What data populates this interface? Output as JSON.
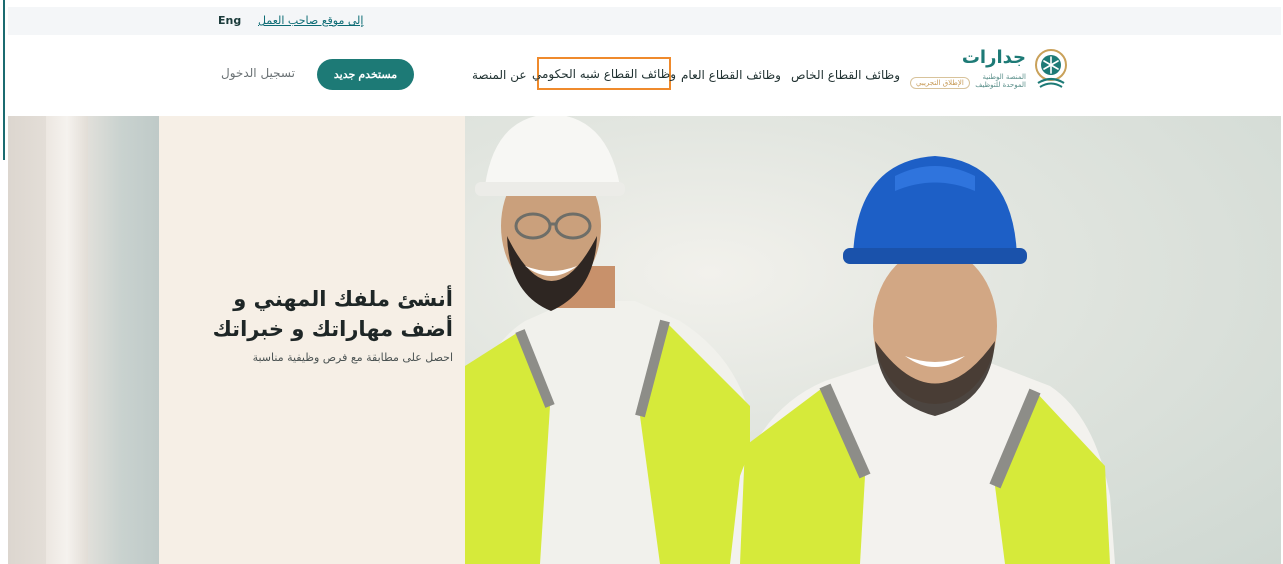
{
  "topbar": {
    "lang_label": "Eng",
    "employer_link": "إلى موقع صاحب العمل"
  },
  "header": {
    "login_label": "تسجيل الدخول",
    "new_user_label": "مستخدم جديد",
    "nav": {
      "about": "عن المنصة",
      "semi_government": "وظائف القطاع شبه الحكومي",
      "public": "وظائف القطاع العام",
      "private": "وظائف القطاع الخاص"
    },
    "logo": {
      "name": "جدارات",
      "subtitle": "المنصة الوطنية الموحدة للتوظيف",
      "beta_badge": "الإطلاق التجريبي"
    }
  },
  "hero": {
    "headline": "أنشئ ملفك المهني و أضف مهاراتك و خبراتك",
    "subline": "احصل على مطابقة مع فرص وظيفية مناسبة"
  },
  "colors": {
    "accent": "#1d7a76",
    "highlight": "#ef8a2c"
  }
}
